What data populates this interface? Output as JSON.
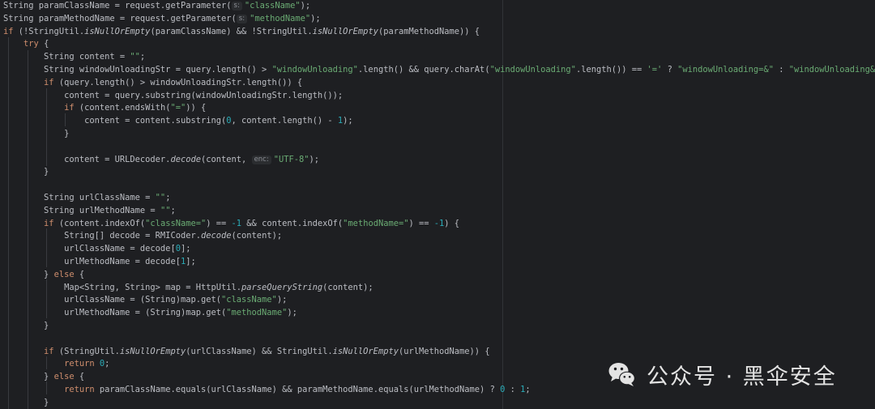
{
  "code_lines": [
    [
      [
        "",
        "String paramClassName = request.getParameter("
      ],
      [
        "hint",
        "s:"
      ],
      [
        "str",
        "\"className\""
      ],
      [
        "",
        ");"
      ]
    ],
    [
      [
        "",
        "String paramMethodName = request.getParameter("
      ],
      [
        "hint",
        "s:"
      ],
      [
        "str",
        "\"methodName\""
      ],
      [
        "",
        ");"
      ]
    ],
    [
      [
        "kw",
        "if"
      ],
      [
        "",
        " (!StringUtil."
      ],
      [
        "it",
        "isNullOrEmpty"
      ],
      [
        "",
        "(paramClassName) && !StringUtil."
      ],
      [
        "it",
        "isNullOrEmpty"
      ],
      [
        "",
        "(paramMethodName)) {"
      ]
    ],
    [
      [
        "",
        "    "
      ],
      [
        "kw",
        "try"
      ],
      [
        "",
        " {"
      ]
    ],
    [
      [
        "",
        "        String content = "
      ],
      [
        "str",
        "\"\""
      ],
      [
        "",
        ";"
      ]
    ],
    [
      [
        "",
        "        String windowUnloadingStr = query.length() > "
      ],
      [
        "str",
        "\"windowUnloading\""
      ],
      [
        "",
        ".length() && query.charAt("
      ],
      [
        "str",
        "\"windowUnloading\""
      ],
      [
        "",
        ".length()) == "
      ],
      [
        "str",
        "'='"
      ],
      [
        "",
        " ? "
      ],
      [
        "str",
        "\"windowUnloading=&\""
      ],
      [
        "",
        " : "
      ],
      [
        "str",
        "\"windowUnloading&\""
      ],
      [
        "",
        ";"
      ]
    ],
    [
      [
        "",
        "        "
      ],
      [
        "kw",
        "if"
      ],
      [
        "",
        " (query.length() > windowUnloadingStr.length()) {"
      ]
    ],
    [
      [
        "",
        "            content = query.substring(windowUnloadingStr.length());"
      ]
    ],
    [
      [
        "",
        "            "
      ],
      [
        "kw",
        "if"
      ],
      [
        "",
        " (content.endsWith("
      ],
      [
        "str",
        "\"=\""
      ],
      [
        "",
        ")) {"
      ]
    ],
    [
      [
        "",
        "                content = content.substring("
      ],
      [
        "num",
        "0"
      ],
      [
        "",
        ", content.length() - "
      ],
      [
        "num",
        "1"
      ],
      [
        "",
        ");"
      ]
    ],
    [
      [
        "",
        "            }"
      ]
    ],
    [
      [
        "",
        ""
      ]
    ],
    [
      [
        "",
        "            content = URLDecoder."
      ],
      [
        "it",
        "decode"
      ],
      [
        "",
        "(content, "
      ],
      [
        "hint",
        "enc:"
      ],
      [
        "str",
        "\"UTF-8\""
      ],
      [
        "",
        ");"
      ]
    ],
    [
      [
        "",
        "        }"
      ]
    ],
    [
      [
        "",
        ""
      ]
    ],
    [
      [
        "",
        "        String urlClassName = "
      ],
      [
        "str",
        "\"\""
      ],
      [
        "",
        ";"
      ]
    ],
    [
      [
        "",
        "        String urlMethodName = "
      ],
      [
        "str",
        "\"\""
      ],
      [
        "",
        ";"
      ]
    ],
    [
      [
        "",
        "        "
      ],
      [
        "kw",
        "if"
      ],
      [
        "",
        " (content.indexOf("
      ],
      [
        "str",
        "\"className=\""
      ],
      [
        "",
        ") == "
      ],
      [
        "num",
        "-1"
      ],
      [
        "",
        " && content.indexOf("
      ],
      [
        "str",
        "\"methodName=\""
      ],
      [
        "",
        ") == "
      ],
      [
        "num",
        "-1"
      ],
      [
        "",
        ") {"
      ]
    ],
    [
      [
        "",
        "            String[] decode = RMICoder."
      ],
      [
        "it",
        "decode"
      ],
      [
        "",
        "(content);"
      ]
    ],
    [
      [
        "",
        "            urlClassName = decode["
      ],
      [
        "num",
        "0"
      ],
      [
        "",
        "];"
      ]
    ],
    [
      [
        "",
        "            urlMethodName = decode["
      ],
      [
        "num",
        "1"
      ],
      [
        "",
        "];"
      ]
    ],
    [
      [
        "",
        "        } "
      ],
      [
        "kw",
        "else"
      ],
      [
        "",
        " {"
      ]
    ],
    [
      [
        "",
        "            Map<String, String> map = HttpUtil."
      ],
      [
        "it",
        "parseQueryString"
      ],
      [
        "",
        "(content);"
      ]
    ],
    [
      [
        "",
        "            urlClassName = (String)map.get("
      ],
      [
        "str",
        "\"className\""
      ],
      [
        "",
        ");"
      ]
    ],
    [
      [
        "",
        "            urlMethodName = (String)map.get("
      ],
      [
        "str",
        "\"methodName\""
      ],
      [
        "",
        ");"
      ]
    ],
    [
      [
        "",
        "        }"
      ]
    ],
    [
      [
        "",
        ""
      ]
    ],
    [
      [
        "",
        "        "
      ],
      [
        "kw",
        "if"
      ],
      [
        "",
        " (StringUtil."
      ],
      [
        "it",
        "isNullOrEmpty"
      ],
      [
        "",
        "(urlClassName) && StringUtil."
      ],
      [
        "it",
        "isNullOrEmpty"
      ],
      [
        "",
        "(urlMethodName)) {"
      ]
    ],
    [
      [
        "",
        "            "
      ],
      [
        "kw",
        "return"
      ],
      [
        "",
        " "
      ],
      [
        "num",
        "0"
      ],
      [
        "",
        ";"
      ]
    ],
    [
      [
        "",
        "        } "
      ],
      [
        "kw",
        "else"
      ],
      [
        "",
        " {"
      ]
    ],
    [
      [
        "",
        "            "
      ],
      [
        "kw",
        "return"
      ],
      [
        "",
        " paramClassName.equals(urlClassName) && paramMethodName.equals(urlMethodName) ? "
      ],
      [
        "num",
        "0"
      ],
      [
        "",
        " : "
      ],
      [
        "num",
        "1"
      ],
      [
        "",
        ";"
      ]
    ],
    [
      [
        "",
        "        }"
      ]
    ]
  ],
  "watermark": {
    "text": "公众号 · 黑伞安全",
    "icon": "wechat-icon"
  },
  "colors": {
    "background": "#1e1f22",
    "text": "#bcbec4",
    "keyword": "#cf8e6d",
    "string": "#6aab73",
    "number": "#2aacb8"
  }
}
